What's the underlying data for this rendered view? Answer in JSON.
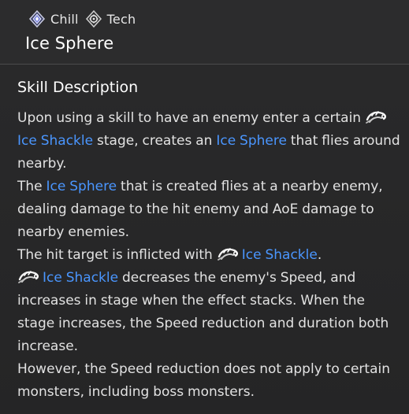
{
  "header": {
    "tags": [
      {
        "label": "Chill",
        "icon": "chill-icon"
      },
      {
        "label": "Tech",
        "icon": "tech-icon"
      }
    ],
    "title": "Ice Sphere"
  },
  "section": {
    "title": "Skill Description"
  },
  "description": {
    "p1_a": "Upon using a skill to have an enemy enter a certain ",
    "p1_kw1": "Ice Shackle",
    "p1_b": " stage, creates an ",
    "p1_kw2": "Ice Sphere",
    "p1_c": " that flies around nearby.",
    "p2_a": "The ",
    "p2_kw1": "Ice Sphere",
    "p2_b": " that is created flies at a nearby enemy, dealing damage to the hit enemy and AoE damage to nearby enemies.",
    "p3_a": "The hit target is inflicted with ",
    "p3_kw1": "Ice Shackle",
    "p3_b": ".",
    "p4_kw1": "Ice Shackle",
    "p4_a": " decreases the enemy's Speed, and increases in stage when the effect stacks. When the stage increases, the Speed reduction and duration both increase.",
    "p5_a": "However, the Speed reduction does not apply to certain monsters, including boss monsters."
  },
  "colors": {
    "keyword": "#4a96ff",
    "background": "#262627",
    "text": "#e2e2e2"
  }
}
